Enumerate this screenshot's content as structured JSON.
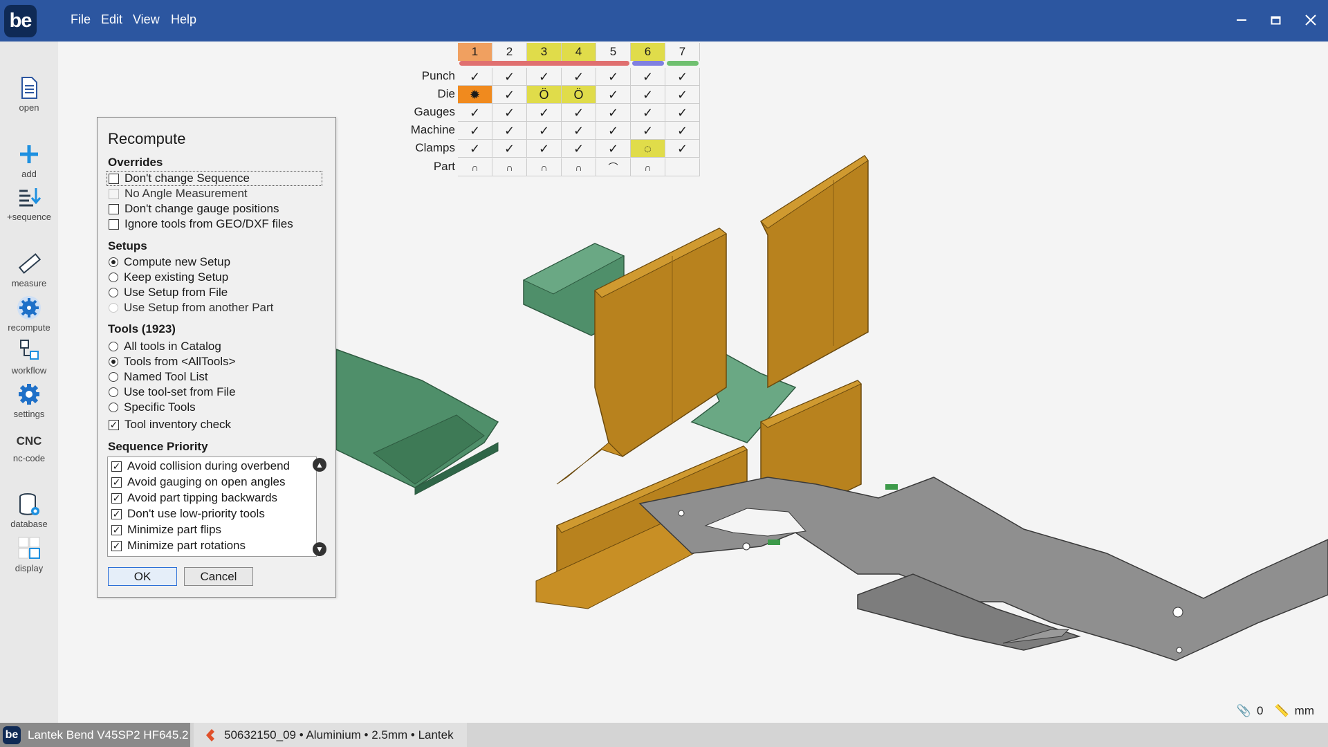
{
  "app": {
    "logo_text": "be",
    "menu": [
      "File",
      "Edit",
      "View",
      "Help"
    ]
  },
  "sidebar": {
    "items": [
      {
        "label": "open",
        "icon": "document-icon"
      },
      {
        "label": "add",
        "icon": "plus-icon"
      },
      {
        "label": "+sequence",
        "icon": "add-sequence-icon"
      },
      {
        "label": "measure",
        "icon": "ruler-icon"
      },
      {
        "label": "recompute",
        "icon": "recompute-icon"
      },
      {
        "label": "workflow",
        "icon": "workflow-icon"
      },
      {
        "label": "settings",
        "icon": "gear-icon"
      },
      {
        "label": "nc-code",
        "icon_text": "CNC"
      },
      {
        "label": "database",
        "icon": "database-icon"
      },
      {
        "label": "display",
        "icon": "display-icon"
      }
    ]
  },
  "tool_table": {
    "columns": [
      "1",
      "2",
      "3",
      "4",
      "5",
      "6",
      "7"
    ],
    "rows": [
      "Punch",
      "Die",
      "Gauges",
      "Machine",
      "Clamps",
      "Part"
    ],
    "check": "✓",
    "colors": {
      "header_highlight": "#e0dc4a",
      "header_orange": "#f0a060",
      "bar_red": "#e07070",
      "bar_blue": "#8080e0",
      "bar_green": "#70c070",
      "error_orange": "#f08a1e"
    }
  },
  "dialog": {
    "title": "Recompute",
    "overrides": {
      "label": "Overrides",
      "options": [
        {
          "label": "Don't change Sequence",
          "checked": false,
          "enabled": true
        },
        {
          "label": "No Angle Measurement",
          "checked": false,
          "enabled": false
        },
        {
          "label": "Don't change gauge positions",
          "checked": false,
          "enabled": true
        },
        {
          "label": "Ignore tools from GEO/DXF files",
          "checked": false,
          "enabled": true
        }
      ]
    },
    "setups": {
      "label": "Setups",
      "options": [
        {
          "label": "Compute new Setup",
          "selected": true,
          "enabled": true
        },
        {
          "label": "Keep existing Setup",
          "selected": false,
          "enabled": true
        },
        {
          "label": "Use Setup from File",
          "selected": false,
          "enabled": true
        },
        {
          "label": "Use Setup from another Part",
          "selected": false,
          "enabled": false
        }
      ]
    },
    "tools": {
      "label": "Tools (1923)",
      "options": [
        {
          "label": "All tools in Catalog",
          "selected": false
        },
        {
          "label": "Tools from <AllTools>",
          "selected": true
        },
        {
          "label": "Named Tool List",
          "selected": false
        },
        {
          "label": "Use tool-set from File",
          "selected": false
        },
        {
          "label": "Specific Tools",
          "selected": false
        }
      ],
      "inventory_check": {
        "label": "Tool inventory check",
        "checked": true
      }
    },
    "priority": {
      "label": "Sequence Priority",
      "items": [
        {
          "label": "Avoid collision during overbend",
          "checked": true
        },
        {
          "label": "Avoid gauging on open angles",
          "checked": true
        },
        {
          "label": "Avoid part tipping backwards",
          "checked": true
        },
        {
          "label": "Don't use low-priority tools",
          "checked": true
        },
        {
          "label": "Minimize part flips",
          "checked": true
        },
        {
          "label": "Minimize part rotations",
          "checked": true
        }
      ]
    },
    "ok_label": "OK",
    "cancel_label": "Cancel"
  },
  "status": {
    "attachments": "0",
    "units": "mm"
  },
  "taskbar": {
    "app_title": "Lantek Bend V45SP2 HF645.2",
    "document": "50632150_09 • Aluminium • 2.5mm • Lantek"
  },
  "colors": {
    "titlebar": "#2c56a0",
    "tool_orange": "#b8821e",
    "tool_green": "#3d8a5e",
    "part_gray": "#8a8a8a"
  }
}
